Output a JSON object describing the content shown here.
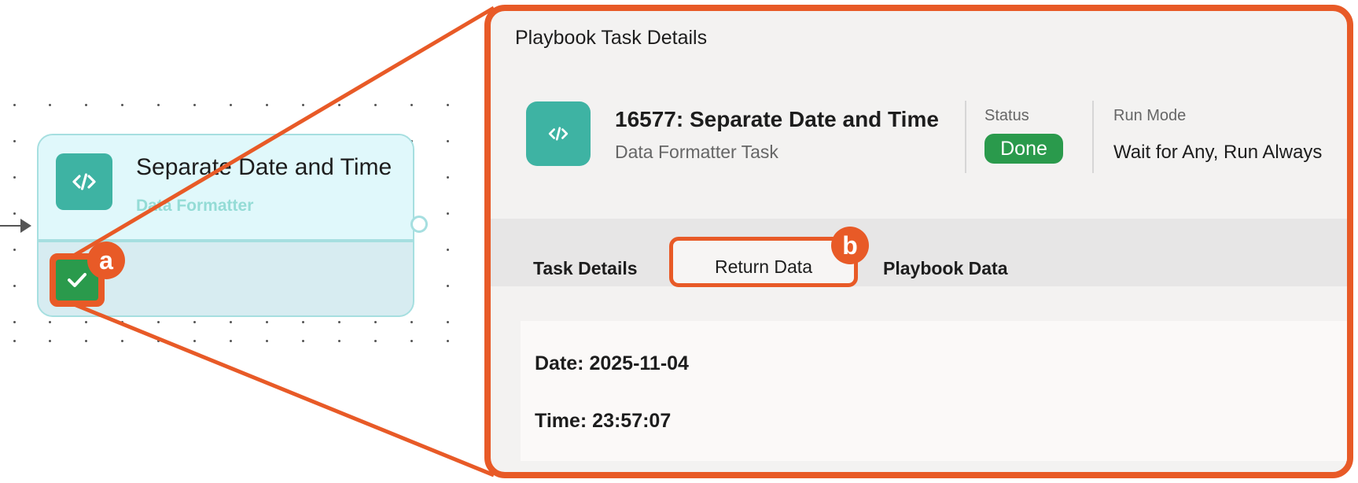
{
  "canvas": {
    "node": {
      "title": "Separate Date and Time",
      "subtitle": "Data Formatter",
      "icon": "code-icon",
      "status_icon": "checkmark-icon"
    },
    "callouts": {
      "a": "a",
      "b": "b"
    }
  },
  "panel": {
    "title": "Playbook Task Details",
    "task": {
      "icon": "code-icon",
      "title": "16577: Separate Date and Time",
      "type": "Data Formatter Task"
    },
    "status": {
      "label": "Status",
      "value": "Done"
    },
    "run_mode": {
      "label": "Run Mode",
      "value": "Wait for Any, Run Always"
    },
    "tabs": [
      {
        "label": "Task Details",
        "active": false
      },
      {
        "label": "Return Data",
        "active": true
      },
      {
        "label": "Playbook Data",
        "active": false
      }
    ],
    "return_data": {
      "date": "Date: 2025-11-04",
      "time": "Time: 23:57:07"
    }
  },
  "colors": {
    "highlight": "#e85a27",
    "task_icon": "#3eb3a3",
    "done_green": "#2a9a4c",
    "node_border": "#a6dfe0",
    "node_top_bg": "#e0f8fb"
  }
}
